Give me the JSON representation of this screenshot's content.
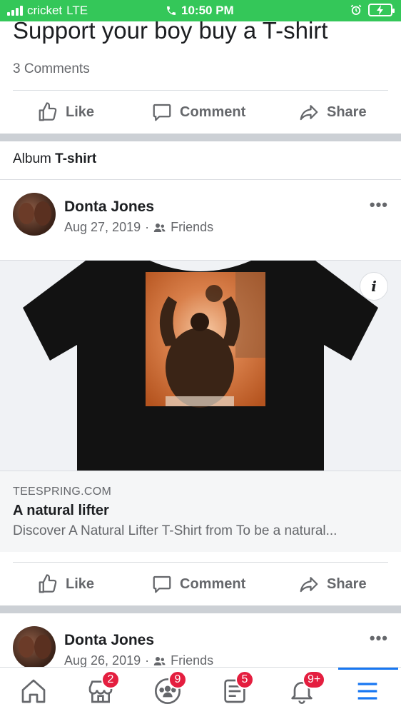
{
  "status_bar": {
    "carrier": "cricket",
    "network": "LTE",
    "time": "10:50 PM",
    "battery_color": "#34c759"
  },
  "post": {
    "title": "Support your boy buy a T-shirt",
    "comments": "3 Comments"
  },
  "actions": {
    "like": "Like",
    "comment": "Comment",
    "share": "Share"
  },
  "album": {
    "prefix": "Album",
    "name": "T-shirt"
  },
  "posts": [
    {
      "author": "Donta Jones",
      "date": "Aug 27, 2019",
      "separator": "·",
      "audience": "Friends",
      "more": "•••"
    },
    {
      "author": "Donta Jones",
      "date": "Aug 26, 2019",
      "separator": "·",
      "audience": "Friends",
      "more": "•••"
    }
  ],
  "link_card": {
    "domain": "TEESPRING.COM",
    "title": "A natural lifter",
    "description": "Discover A Natural Lifter T-Shirt from To be a natural...",
    "info": "i"
  },
  "bottom_nav": {
    "items": [
      {
        "icon": "home-icon",
        "badge": ""
      },
      {
        "icon": "marketplace-icon",
        "badge": "2"
      },
      {
        "icon": "groups-icon",
        "badge": "9"
      },
      {
        "icon": "news-icon",
        "badge": "5"
      },
      {
        "icon": "bell-icon",
        "badge": "9+"
      },
      {
        "icon": "menu-icon",
        "badge": ""
      }
    ],
    "accent": "#1877f2",
    "badge_color": "#e41e3f"
  }
}
